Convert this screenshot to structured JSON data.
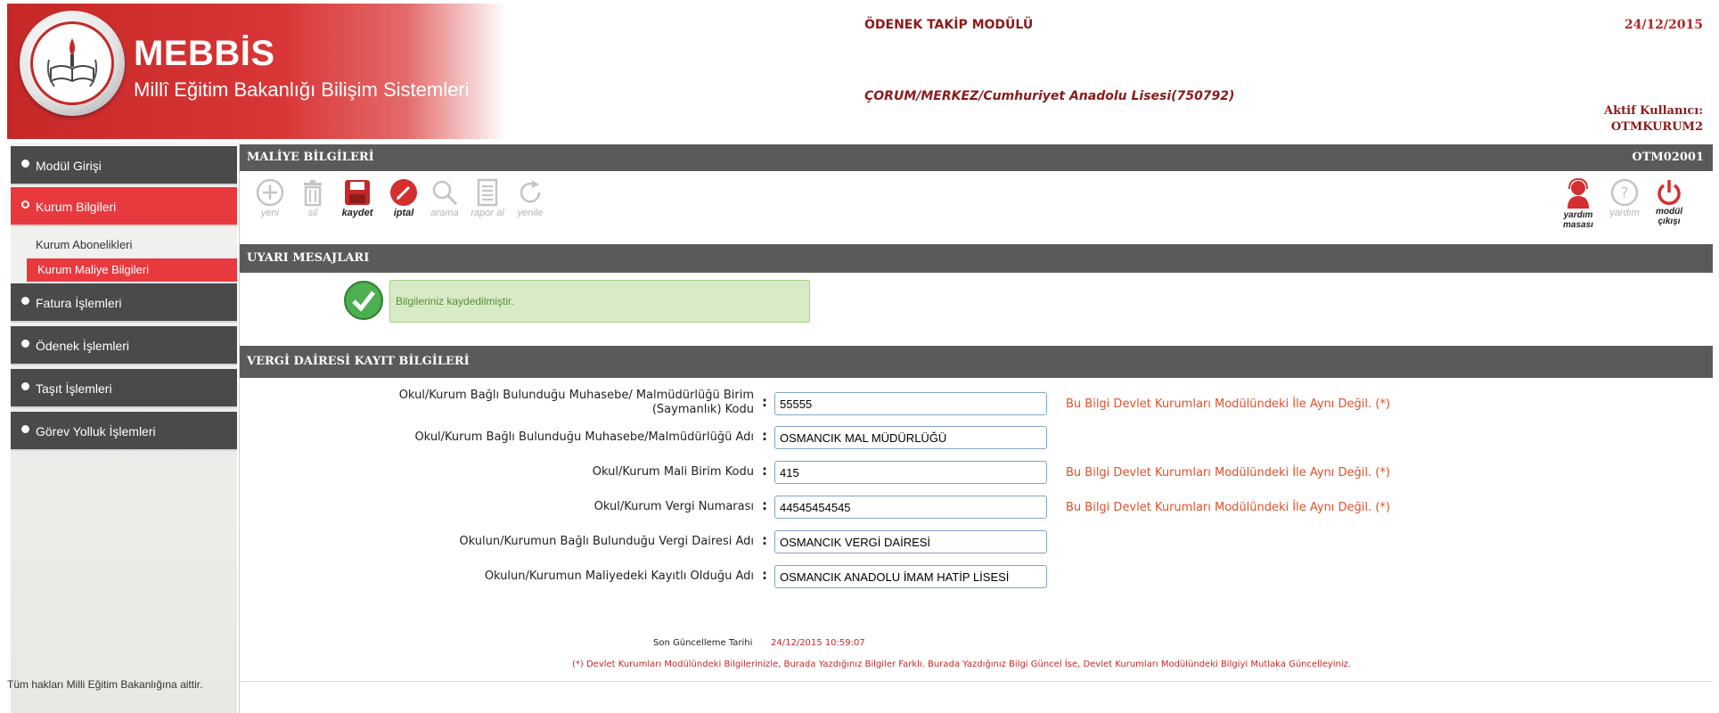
{
  "header": {
    "brand_title": "MEBBİS",
    "brand_subtitle": "Millî Eğitim Bakanlığı Bilişim Sistemleri",
    "module_title": "ÖDENEK TAKİP MODÜLÜ",
    "date": "24/12/2015",
    "school": "ÇORUM/MERKEZ/Cumhuriyet Anadolu Lisesi(750792)",
    "user_label": "Aktif Kullanıcı:",
    "user_name": "OTMKURUM2"
  },
  "sidebar": {
    "items": [
      {
        "label": "Modül Girişi"
      },
      {
        "label": "Kurum Bilgileri"
      },
      {
        "label": "Fatura İşlemleri"
      },
      {
        "label": "Ödenek İşlemleri"
      },
      {
        "label": "Taşıt İşlemleri"
      },
      {
        "label": "Görev Yolluk İşlemleri"
      }
    ],
    "subitems": [
      {
        "label": "Kurum Abonelikleri"
      },
      {
        "label": "Kurum Maliye Bilgileri"
      }
    ],
    "copyright": "Tüm hakları Milli Eğitim Bakanlığına aittir."
  },
  "main": {
    "title": "MALİYE BİLGİLERİ",
    "page_code": "OTM02001",
    "toolbar": {
      "yeni": "yeni",
      "sil": "sil",
      "kaydet": "kaydet",
      "iptal": "iptal",
      "arama": "arama",
      "rapor_al": "rapor al",
      "yenile": "yenile",
      "yardim_masasi_1": "yardım",
      "yardim_masasi_2": "masası",
      "yardim": "yardım",
      "modul_cikisi_1": "modül",
      "modul_cikisi_2": "çıkışı"
    },
    "warnings_title": "UYARI MESAJLARI",
    "alert_message": "Bilgileriniz kaydedilmiştir.",
    "section_title": "VERGİ DAİRESİ KAYIT BİLGİLERİ",
    "form": {
      "row1_label_1": "Okul/Kurum Bağlı Bulunduğu Muhasebe/ Malmüdürlüğü Birim",
      "row1_label_2": "(Saymanlık) Kodu",
      "row1_value": "55555",
      "row2_label": "Okul/Kurum Bağlı Bulunduğu Muhasebe/Malmüdürlüğü Adı",
      "row2_value": "OSMANCIK MAL MÜDÜRLÜĞÜ",
      "row3_label": "Okul/Kurum Mali Birim Kodu",
      "row3_value": "415",
      "row4_label": "Okul/Kurum Vergi Numarası",
      "row4_value": "44545454545",
      "row5_label": "Okulun/Kurumun Bağlı Bulunduğu Vergi Dairesi Adı",
      "row5_value": "OSMANCIK VERGİ DAİRESİ",
      "row6_label": "Okulun/Kurumun Maliyedeki Kayıtlı Olduğu Adı",
      "row6_value": "OSMANCIK ANADOLU İMAM HATİP LİSESİ",
      "colon": ":",
      "warning": "Bu Bilgi Devlet Kurumları Modülündeki İle Aynı Değil. (*)"
    },
    "footer": {
      "last_update_label": "Son Güncelleme Tarihi",
      "last_update_value": "24/12/2015 10:59:07",
      "note": "(*) Devlet Kurumları Modülündeki Bilgilerinizle, Burada Yazdığınız Bilgiler Farklı. Burada Yazdığınız Bilgi Güncel İse, Devlet Kurumları Modülündeki Bilgiyi Mutlaka Güncelleyiniz."
    }
  },
  "colors": {
    "brand_red": "#e8393e",
    "dark_bar": "#5a5a5a",
    "success_bg": "#d7ecc6",
    "warning_text": "#e0502a"
  }
}
